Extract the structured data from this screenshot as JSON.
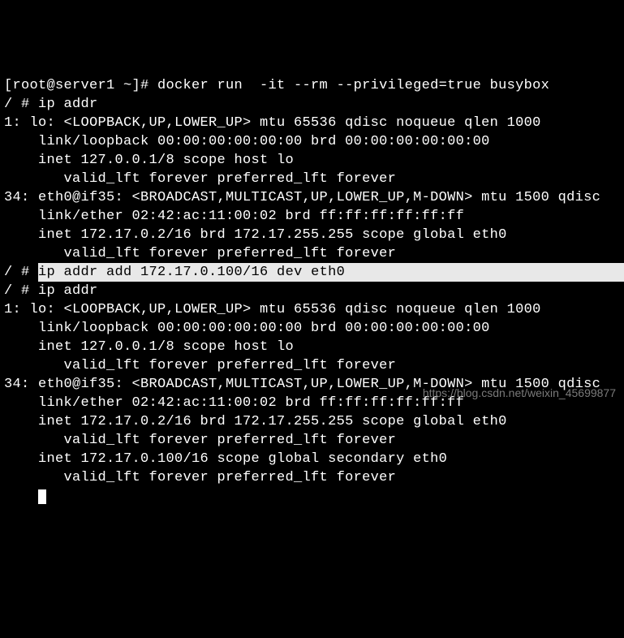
{
  "terminal": {
    "lines": [
      {
        "prefix": "",
        "text": "[root@server1 ~]# docker run  -it --rm --privileged=true busybox",
        "highlight": false
      },
      {
        "prefix": "",
        "text": "/ # ip addr",
        "highlight": false
      },
      {
        "prefix": "",
        "text": "1: lo: <LOOPBACK,UP,LOWER_UP> mtu 65536 qdisc noqueue qlen 1000",
        "highlight": false
      },
      {
        "prefix": "",
        "text": "    link/loopback 00:00:00:00:00:00 brd 00:00:00:00:00:00",
        "highlight": false
      },
      {
        "prefix": "",
        "text": "    inet 127.0.0.1/8 scope host lo",
        "highlight": false
      },
      {
        "prefix": "",
        "text": "       valid_lft forever preferred_lft forever",
        "highlight": false
      },
      {
        "prefix": "",
        "text": "34: eth0@if35: <BROADCAST,MULTICAST,UP,LOWER_UP,M-DOWN> mtu 1500 qdisc",
        "highlight": false
      },
      {
        "prefix": "",
        "text": "    link/ether 02:42:ac:11:00:02 brd ff:ff:ff:ff:ff:ff",
        "highlight": false
      },
      {
        "prefix": "",
        "text": "    inet 172.17.0.2/16 brd 172.17.255.255 scope global eth0",
        "highlight": false
      },
      {
        "prefix": "",
        "text": "       valid_lft forever preferred_lft forever",
        "highlight": false
      },
      {
        "prefix": "/ # ",
        "text": "ip addr add 172.17.0.100/16 dev eth0",
        "highlight": true,
        "trailing_highlight": true
      },
      {
        "prefix": "",
        "text": "/ # ip addr",
        "highlight": false
      },
      {
        "prefix": "",
        "text": "1: lo: <LOOPBACK,UP,LOWER_UP> mtu 65536 qdisc noqueue qlen 1000",
        "highlight": false
      },
      {
        "prefix": "",
        "text": "    link/loopback 00:00:00:00:00:00 brd 00:00:00:00:00:00",
        "highlight": false
      },
      {
        "prefix": "",
        "text": "    inet 127.0.0.1/8 scope host lo",
        "highlight": false
      },
      {
        "prefix": "",
        "text": "       valid_lft forever preferred_lft forever",
        "highlight": false
      },
      {
        "prefix": "",
        "text": "34: eth0@if35: <BROADCAST,MULTICAST,UP,LOWER_UP,M-DOWN> mtu 1500 qdisc",
        "highlight": false
      },
      {
        "prefix": "",
        "text": "    link/ether 02:42:ac:11:00:02 brd ff:ff:ff:ff:ff:ff",
        "highlight": false
      },
      {
        "prefix": "",
        "text": "    inet 172.17.0.2/16 brd 172.17.255.255 scope global eth0",
        "highlight": false
      },
      {
        "prefix": "",
        "text": "       valid_lft forever preferred_lft forever",
        "highlight": false
      },
      {
        "prefix": "",
        "text": "    inet 172.17.0.100/16 scope global secondary eth0",
        "highlight": false
      },
      {
        "prefix": "",
        "text": "       valid_lft forever preferred_lft forever",
        "highlight": false
      }
    ],
    "prompt_final": "    "
  },
  "watermark": "https://blog.csdn.net/weixin_45699877"
}
